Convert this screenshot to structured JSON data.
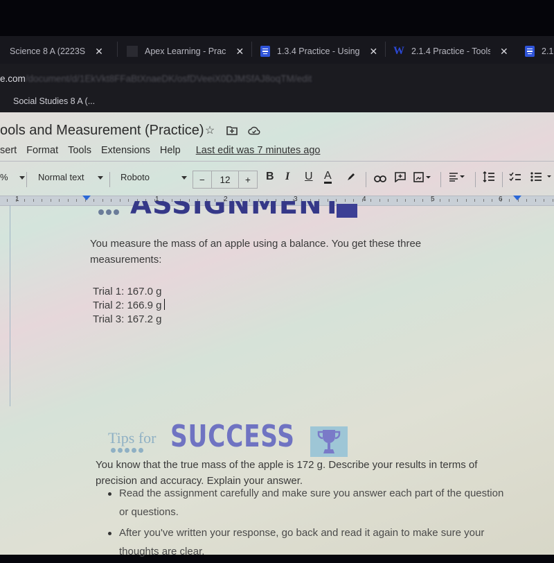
{
  "browser": {
    "tabs": [
      {
        "title": "Science 8 A (2223S",
        "icon": "generic-icon"
      },
      {
        "title": "Apex Learning - Prac",
        "icon": "apex-icon"
      },
      {
        "title": "1.3.4 Practice - Using",
        "icon": "docs-icon"
      },
      {
        "title": "2.1.4 Practice - Tools",
        "icon": "word-icon"
      },
      {
        "title": "2.1",
        "icon": "docs-icon"
      }
    ],
    "close_glyph": "✕",
    "url_visible": "e.com",
    "url_blurred": "/document/d/1EkVkt8FFaBtXnaeDK/osfDVeeiX0DJMSfAJ8oqTM/edit",
    "bookmarks": [
      {
        "label": "Social Studies 8 A (..."
      }
    ]
  },
  "docs": {
    "title": "ools and Measurement (Practice)",
    "title_icons": [
      "star-icon",
      "move-to-folder-icon",
      "cloud-saved-icon"
    ],
    "menu": [
      "sert",
      "Format",
      "Tools",
      "Extensions",
      "Help"
    ],
    "last_edit": "Last edit was 7 minutes ago",
    "toolbar": {
      "zoom_suffix": "%",
      "style": "Normal text",
      "font": "Roboto",
      "font_size": "12",
      "minus": "−",
      "plus": "+",
      "bold": "B",
      "italic": "I",
      "underline": "U",
      "text_color": "A"
    },
    "ruler": {
      "labels": [
        "1",
        "1",
        "2",
        "3",
        "4",
        "5",
        "6"
      ]
    }
  },
  "document": {
    "banner_word": "ASSIGNMENT",
    "intro": "You measure the mass of an apple using a balance. You get these three measurements:",
    "trials": [
      "Trial 1: 167.0 g",
      "Trial 2: 166.9 g",
      "Trial 3: 167.2 g"
    ],
    "question": "You know that the true mass of the apple is 172 g. Describe your results in terms of precision and accuracy. Explain your answer.",
    "tips": {
      "prefix": "Tips for",
      "word": "SUCCESS"
    },
    "bullets": [
      "Read the assignment carefully and make sure you answer each part of the question or questions.",
      "After you've written your response, go back and read it again to make sure your thoughts are clear."
    ]
  }
}
